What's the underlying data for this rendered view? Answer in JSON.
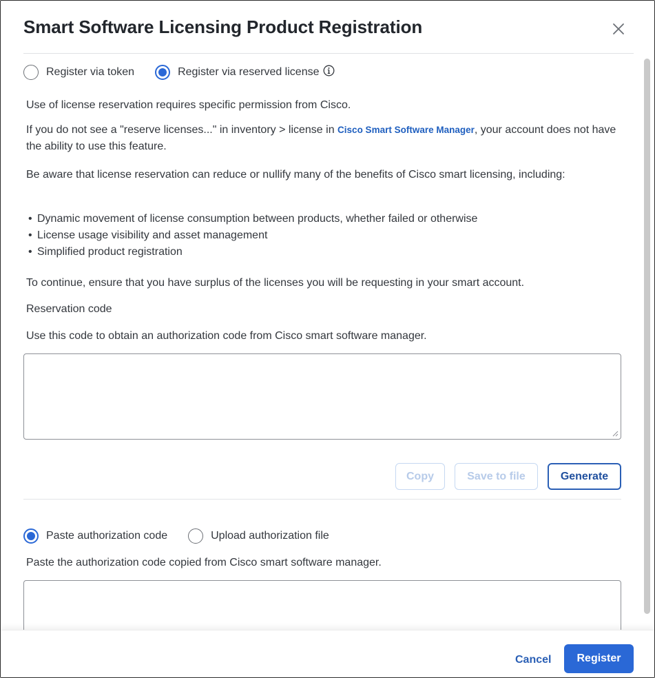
{
  "dialog": {
    "title": "Smart Software Licensing Product Registration",
    "close_label": "×"
  },
  "registration_method": {
    "options": [
      {
        "label": "Register via token",
        "selected": false
      },
      {
        "label": "Register via reserved license",
        "selected": true
      }
    ]
  },
  "content": {
    "permission_notice": "Use of license reservation requires specific permission from Cisco.",
    "inventory_notice_prefix": "If you do not see a \"reserve licenses...\" in inventory > license in ",
    "inventory_notice_link": "Cisco Smart Software Manager",
    "inventory_notice_suffix": ", your account does not have the ability to use this feature.",
    "benefits_warning": "Be aware that license reservation can reduce or nullify many of the benefits of Cisco smart licensing, including:",
    "benefits": [
      "Dynamic movement of license consumption between products, whether failed or otherwise",
      "License usage visibility and asset management",
      "Simplified product registration"
    ],
    "surplus_notice": "To continue, ensure that you have surplus of the licenses you will be requesting in your smart account.",
    "reservation_code_label": "Reservation code",
    "reservation_code_help": "Use this code to obtain an authorization code from Cisco smart software manager.",
    "reservation_code_value": ""
  },
  "reservation_actions": {
    "copy_label": "Copy",
    "save_label": "Save to file",
    "generate_label": "Generate"
  },
  "authorization_method": {
    "options": [
      {
        "label": "Paste authorization code",
        "selected": true
      },
      {
        "label": "Upload authorization file",
        "selected": false
      }
    ],
    "paste_help": "Paste the authorization code copied from Cisco smart software manager.",
    "authorization_code_value": ""
  },
  "footer": {
    "cancel_label": "Cancel",
    "register_label": "Register"
  },
  "colors": {
    "accent": "#2a68d6",
    "link": "#1f5fbf",
    "disabled_button_text": "#b7cbe9"
  }
}
